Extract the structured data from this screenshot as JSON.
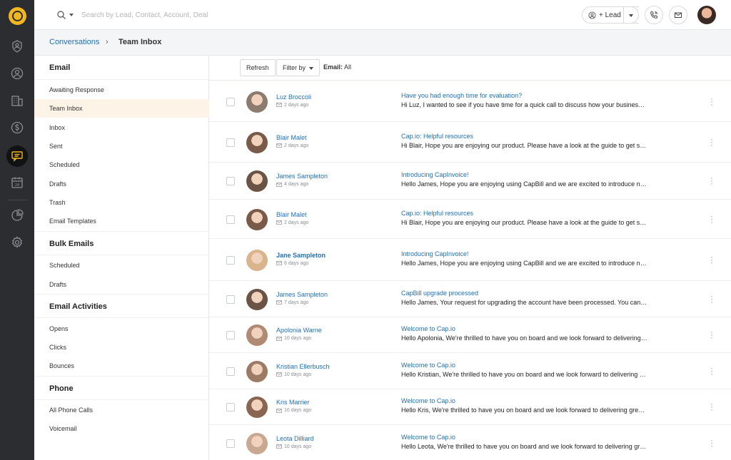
{
  "topbar": {
    "search_placeholder": "Search by Lead, Contact, Account, Deal",
    "lead_label": "+ Lead"
  },
  "breadcrumb": {
    "parent": "Conversations",
    "separator": "›",
    "current": "Team Inbox"
  },
  "sidebar": {
    "sections": [
      {
        "title": "Email",
        "items": [
          "Awaiting Response",
          "Team Inbox",
          "Inbox",
          "Sent",
          "Scheduled",
          "Drafts",
          "Trash",
          "Email Templates"
        ]
      },
      {
        "title": "Bulk Emails",
        "items": [
          "Scheduled",
          "Drafts"
        ]
      },
      {
        "title": "Email Activities",
        "items": [
          "Opens",
          "Clicks",
          "Bounces"
        ]
      },
      {
        "title": "Phone",
        "items": [
          "All Phone Calls",
          "Voicemail"
        ]
      }
    ],
    "active_item": "Team Inbox"
  },
  "toolbar": {
    "refresh_label": "Refresh",
    "filter_label": "Filter by",
    "email_filter_key": "Email:",
    "email_filter_value": "All"
  },
  "rows": [
    {
      "name": "Luz Broccoli",
      "time": "2 days ago",
      "subject": "Have you had enough time for evaluation?",
      "preview": "Hi Luz,  I wanted to see if you have time for a quick call to discuss how your business is going",
      "avatar_color": "#8c7b6e"
    },
    {
      "name": "Blair Malet",
      "time": "2 days ago",
      "subject": "Cap.io: Helpful resources",
      "preview": "Hi Blair, Hope you are enjoying our product. Please have a look at the guide to get started",
      "avatar_color": "#7a5a48"
    },
    {
      "name": "James Sampleton",
      "time": "4 days ago",
      "subject": "Introducing CapInvoice!",
      "preview": "Hello James, Hope you are enjoying using CapBill and we are excited to introduce new features",
      "avatar_color": "#6b5446"
    },
    {
      "name": "Blair Malet",
      "time": "2 days ago",
      "subject": "Cap.io: Helpful resources",
      "preview": "Hi Blair, Hope you are enjoying our product. Please have a look at the guide to get started",
      "avatar_color": "#7a5a48"
    },
    {
      "name": "Jane Sampleton",
      "time": "6 days ago",
      "subject": "Introducing CapInvoice!",
      "preview": "Hello James, Hope you are enjoying using CapBill and we are excited to introduce new features",
      "avatar_color": "#d9b48c",
      "bold": true
    },
    {
      "name": "James Sampleton",
      "time": "7 days ago",
      "subject": "CapBill upgrade processed",
      "preview": "Hello James, Your request for upgrading the account have been processed. You can now continue",
      "avatar_color": "#6b5446"
    },
    {
      "name": "Apolonia Warne",
      "time": "10 days ago",
      "subject": "Welcome to Cap.io",
      "preview": "Hello Apolonia, We're thrilled to have you on board and we look forward to delivering great value",
      "avatar_color": "#b08a72"
    },
    {
      "name": "Kristian Ellerbusch",
      "time": "10 days ago",
      "subject": "Welcome to Cap.io",
      "preview": "Hello Kristian, We're thrilled to have you on board and we look forward to delivering great value",
      "avatar_color": "#9c7a64"
    },
    {
      "name": "Kris Marrier",
      "time": "10 days ago",
      "subject": "Welcome to Cap.io",
      "preview": "Hello Kris, We're thrilled to have you on board and we look forward to delivering great value",
      "avatar_color": "#8a6652"
    },
    {
      "name": "Leota Dilliard",
      "time": "10 days ago",
      "subject": "Welcome to Cap.io",
      "preview": "Hello Leota, We're thrilled to have you on board and we look forward to delivering great value",
      "avatar_color": "#c9a891"
    }
  ],
  "colors": {
    "accent": "#1f6fb5",
    "rail": "#2b2d31",
    "logo": "#f2b620",
    "active_bg": "#fdf3e6"
  }
}
